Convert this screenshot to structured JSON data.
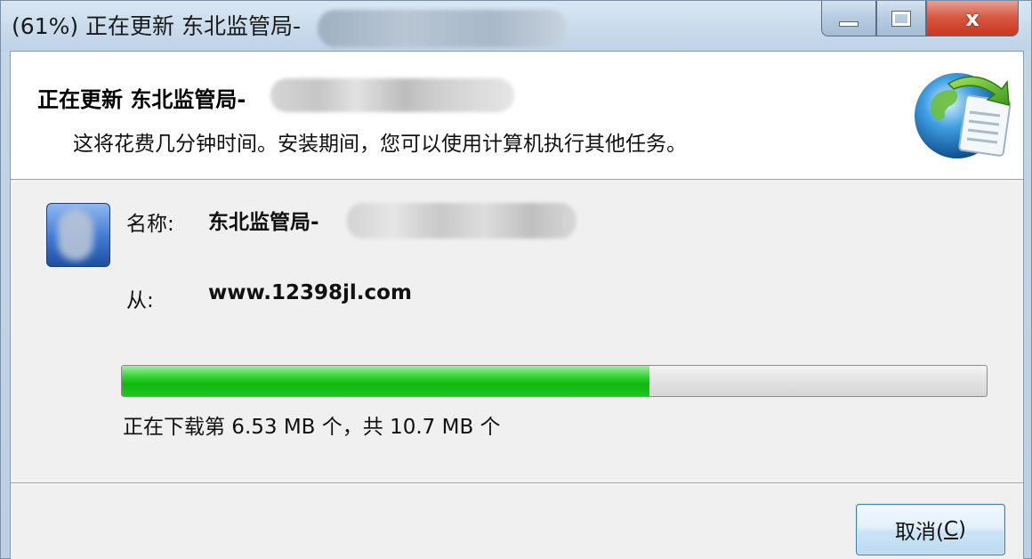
{
  "window": {
    "title": "(61%) 正在更新 东北监管局-",
    "controls": {
      "minimize_icon": "minimize-icon",
      "maximize_icon": "maximize-icon",
      "close_icon": "close-icon",
      "close_glyph": "x"
    }
  },
  "header": {
    "title": "正在更新 东北监管局-",
    "description": "这将花费几分钟时间。安装期间，您可以使用计算机执行其他任务。",
    "icon": "globe-update-icon"
  },
  "details": {
    "app_icon": "application-icon",
    "name_label": "名称:",
    "name_value": "东北监管局-",
    "from_label": "从:",
    "from_value": "www.12398jl.com"
  },
  "progress": {
    "percent": 61,
    "status": "正在下载第 6.53 MB 个，共 10.7 MB 个"
  },
  "footer": {
    "cancel_label_prefix": "取消(",
    "cancel_accel": "C",
    "cancel_label_suffix": ")"
  },
  "colors": {
    "progress_green": "#0fb80f",
    "close_red": "#c8381f",
    "button_border": "#3c7fb1"
  }
}
